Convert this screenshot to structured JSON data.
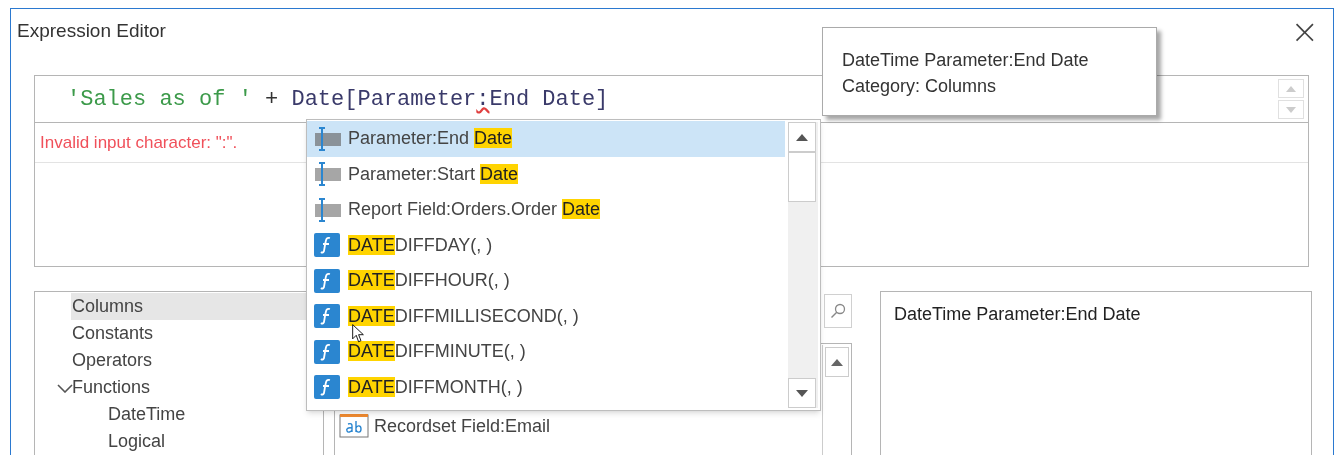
{
  "window": {
    "title": "Expression Editor",
    "close": "×"
  },
  "expression": {
    "parts": [
      {
        "kind": "string",
        "text": "'Sales as of '"
      },
      {
        "kind": "operator",
        "text": " + "
      },
      {
        "kind": "identifier",
        "text": "Date[Parameter"
      },
      {
        "kind": "error",
        "text": ":"
      },
      {
        "kind": "identifier",
        "text": "End Date]"
      }
    ]
  },
  "error_message": "Invalid input character: \":\".",
  "autocomplete": {
    "items": [
      {
        "kind": "parameter",
        "prefix": "Parameter:End ",
        "match": "Date",
        "selected": true
      },
      {
        "kind": "parameter",
        "prefix": "Parameter:Start ",
        "match": "Date",
        "selected": false
      },
      {
        "kind": "parameter",
        "prefix": "Report Field:Orders.Order ",
        "match": "Date",
        "selected": false
      },
      {
        "kind": "function",
        "match": "DATE",
        "suffix": "DIFFDAY(, )",
        "selected": false
      },
      {
        "kind": "function",
        "match": "DATE",
        "suffix": "DIFFHOUR(, )",
        "selected": false
      },
      {
        "kind": "function",
        "match": "DATE",
        "suffix": "DIFFMILLISECOND(, )",
        "selected": false
      },
      {
        "kind": "function",
        "match": "DATE",
        "suffix": "DIFFMINUTE(, )",
        "selected": false
      },
      {
        "kind": "function",
        "match": "DATE",
        "suffix": "DIFFMONTH(, )",
        "selected": false
      }
    ]
  },
  "tooltip": {
    "lines": [
      "DateTime Parameter:End Date",
      "Category: Columns"
    ]
  },
  "categories": {
    "items": [
      {
        "label": "Columns",
        "selected": true
      },
      {
        "label": "Constants",
        "selected": false
      },
      {
        "label": "Operators",
        "selected": false
      },
      {
        "label": "Functions",
        "selected": false,
        "expanded": true,
        "children": [
          {
            "label": "DateTime",
            "selected": false
          },
          {
            "label": "Logical",
            "selected": false
          }
        ]
      }
    ]
  },
  "column_list": {
    "items": [
      {
        "kind": "text_field",
        "label": "Recordset Field:Email"
      }
    ]
  },
  "description": "DateTime Parameter:End Date"
}
